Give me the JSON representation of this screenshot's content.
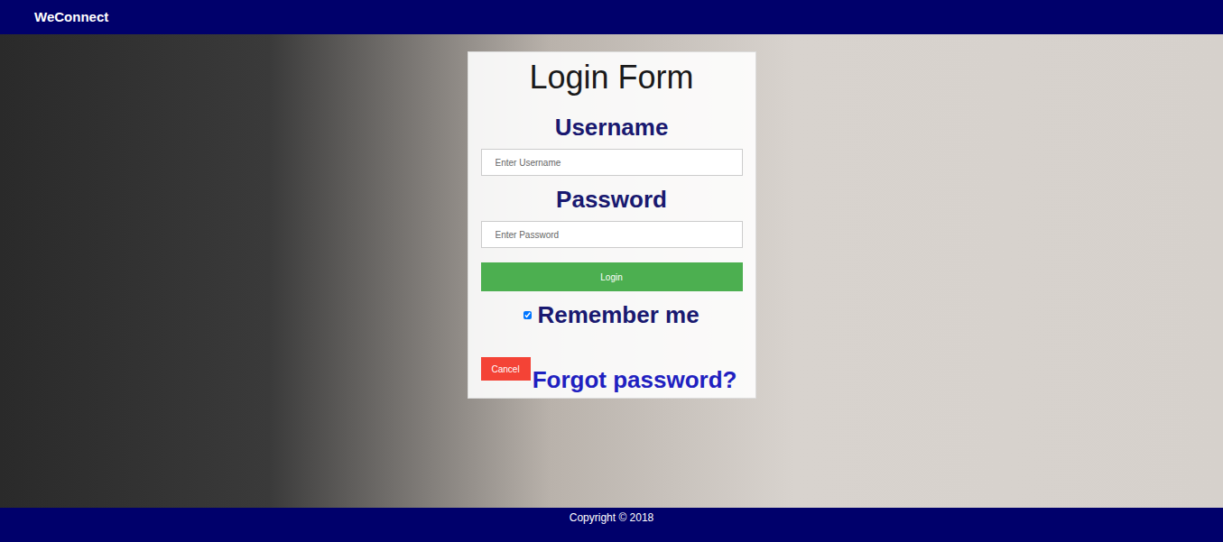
{
  "navbar": {
    "brand": "WeConnect"
  },
  "form": {
    "title": "Login Form",
    "fields": [
      {
        "label": "Username",
        "placeholder": "Enter Username",
        "kind": "text"
      },
      {
        "label": "Password",
        "placeholder": "Enter Password",
        "kind": "password"
      }
    ],
    "login_button": "Login",
    "remember": {
      "label": "Remember me",
      "checked": true
    },
    "cancel_button": "Cancel",
    "forgot_link": "Forgot password?"
  },
  "footer": {
    "text": "Copyright © 2018"
  }
}
